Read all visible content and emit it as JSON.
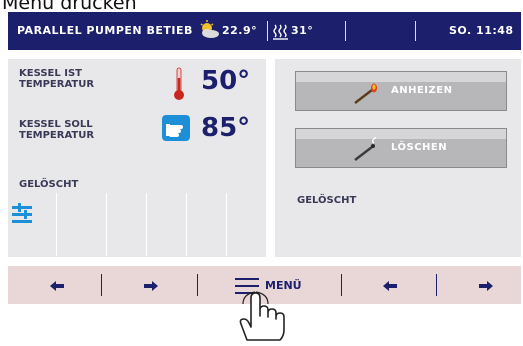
{
  "caption": "Menü drücken",
  "topbar": {
    "status": "PARALLEL PUMPEN BETIEB",
    "outdoor_temp": "22.9°",
    "heating_temp": "31°",
    "datetime": "SO. 11:48"
  },
  "boiler": {
    "actual_label_1": "KESSEL IST",
    "actual_label_2": "TEMPERATUR",
    "actual_value": "50°",
    "set_label_1": "KESSEL SOLL",
    "set_label_2": "TEMPERATUR",
    "set_value": "85°",
    "status_left": "GELÖSCHT"
  },
  "actions": {
    "ignite_label": "ANHEIZEN",
    "extinguish_label": "LÖSCHEN",
    "status_right": "GELÖSCHT"
  },
  "nav": {
    "menu_label": "MENÜ"
  },
  "colors": {
    "topbar": "#1c1f6b",
    "panel": "#e8e8ea",
    "navbar": "#e9d6d6",
    "accent_blue": "#1c8fd6",
    "thermometer_red": "#c8261e"
  }
}
